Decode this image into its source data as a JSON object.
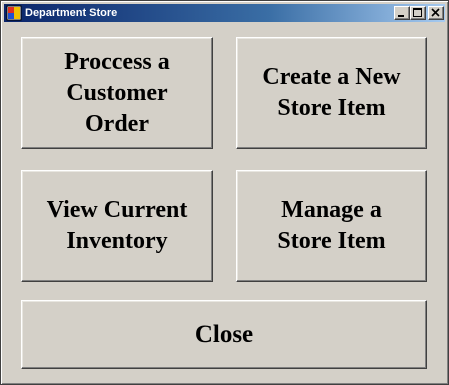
{
  "window": {
    "title": "Department Store",
    "icon": "application-icon"
  },
  "titlebar_controls": {
    "minimize_icon": "minimize-icon",
    "maximize_icon": "maximize-icon",
    "close_icon": "close-icon"
  },
  "buttons": {
    "process_order": "Proccess a\nCustomer\nOrder",
    "create_item": "Create a New\nStore Item",
    "view_inventory": "View Current\nInventory",
    "manage_item": "Manage a\nStore Item",
    "close": "Close"
  }
}
